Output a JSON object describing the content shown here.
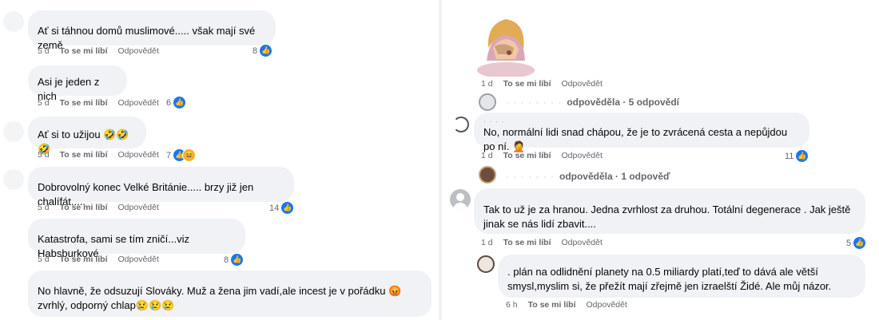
{
  "left": {
    "comments": [
      {
        "text": "Ať si táhnou domů muslimové..... však mají své země",
        "time": "5 d",
        "like": "To se mi líbí",
        "reply": "Odpovědět",
        "count": "8"
      },
      {
        "text": "Asi je jeden z nich",
        "time": "5 d",
        "like": "To se mi líbí",
        "reply": "Odpovědět",
        "count": "6"
      },
      {
        "text": "Ať si to užijou 🤣🤣🤣",
        "time": "5 d",
        "like": "To se mi líbí",
        "reply": "Odpovědět",
        "count": "7"
      },
      {
        "text": "Dobrovolný konec Velké Británie..... brzy již jen chalífát.....",
        "time": "5 d",
        "like": "To se mi líbí",
        "reply": "Odpovědět",
        "count": "14"
      },
      {
        "text": "Katastrofa, sami se tím zničí...viz Habsburkové",
        "time": "5 d",
        "like": "To se mi líbí",
        "reply": "Odpovědět",
        "count": "8"
      },
      {
        "text": "No hlavně, že odsuzují Slováky. Muž a žena jim vadí,ale incest je v pořádku 😡 zvrhlý, odporný chlap😢😢😢"
      }
    ]
  },
  "right": {
    "top_meta": {
      "time": "1 d",
      "like": "To se mi líbí",
      "reply": "Odpovědět"
    },
    "thread1": {
      "blurred": "· · · · · · · ·",
      "replies": "odpověděla · 5 odpovědí"
    },
    "c1": {
      "name": "· · · ·",
      "text": "No, normální lidi snad chápou, že je to zvrácená cesta a nepůjdou po ní. 🤦",
      "time": "1 d",
      "like": "To se mi líbí",
      "reply": "Odpovědět",
      "count": "11"
    },
    "thread2": {
      "blurred": "· · · · · · ·",
      "replies": "odpověděla · 1 odpověď"
    },
    "c2": {
      "text": "Tak to už je za hranou. Jedna zvrhlost za druhou. Totální degenerace . Jak ještě jinak se nás lidí zbavit....",
      "time": "1 d",
      "like": "To se mi líbí",
      "reply": "Odpovědět",
      "count": "5"
    },
    "c3": {
      "text": ". plán na odlidnění planety na 0.5 miliardy platí,teď to dává ale větší smysl,myslim si, že přežít mají zřejmě jen izraelští Židé. Ale můj názor.",
      "time": "6 h",
      "like": "To se mi líbí",
      "reply": "Odpovědět"
    }
  },
  "icons": {
    "like": "thumbs-up-icon",
    "haha": "laughing-face-icon"
  },
  "colors": {
    "bubble": "#f0f2f5",
    "like_blue": "#1877f2",
    "meta_gray": "#65676b"
  }
}
